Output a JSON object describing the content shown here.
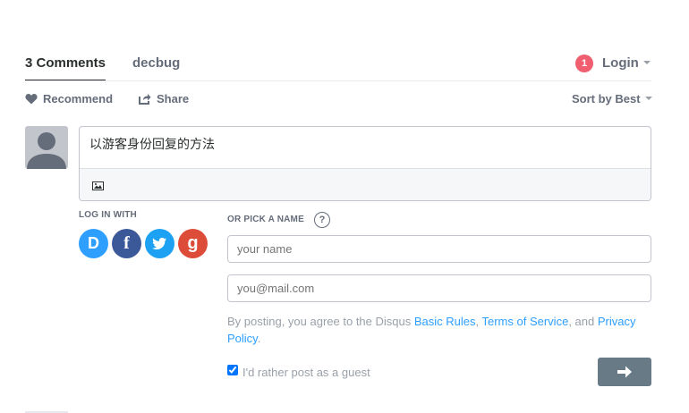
{
  "nav": {
    "comments_tab": "3 Comments",
    "forum_tab": "decbug",
    "notification_count": "1",
    "login_label": "Login"
  },
  "toolbar": {
    "recommend_label": "Recommend",
    "share_label": "Share",
    "sort_label": "Sort by Best"
  },
  "composer": {
    "text": "以游客身份回复的方法",
    "image_icon": "image-icon"
  },
  "login_with": {
    "label": "LOG IN WITH",
    "providers": [
      {
        "name": "disqus",
        "glyph": "D",
        "color": "#2e9fff"
      },
      {
        "name": "facebook",
        "glyph": "f",
        "color": "#3b5998"
      },
      {
        "name": "twitter",
        "glyph": "twitter-bird-icon",
        "color": "#1da1f2"
      },
      {
        "name": "google",
        "glyph": "g",
        "color": "#dd4b39"
      }
    ]
  },
  "guest": {
    "label": "OR PICK A NAME",
    "help_glyph": "?",
    "name_placeholder": "your name",
    "email_placeholder": "you@mail.com",
    "terms_prefix": "By posting, you agree to the Disqus ",
    "terms_link1": "Basic Rules",
    "terms_sep1": ", ",
    "terms_link2": "Terms of Service",
    "terms_sep2": ", and ",
    "terms_link3": "Privacy Policy",
    "terms_suffix": ".",
    "guest_checkbox_label": "I'd rather post as a guest",
    "guest_checked": true,
    "submit_icon": "arrow-right-icon"
  },
  "colors": {
    "accent": "#2e9fff",
    "badge": "#f05f70",
    "submit_bg": "#687a86",
    "muted_text": "#656c7a"
  }
}
